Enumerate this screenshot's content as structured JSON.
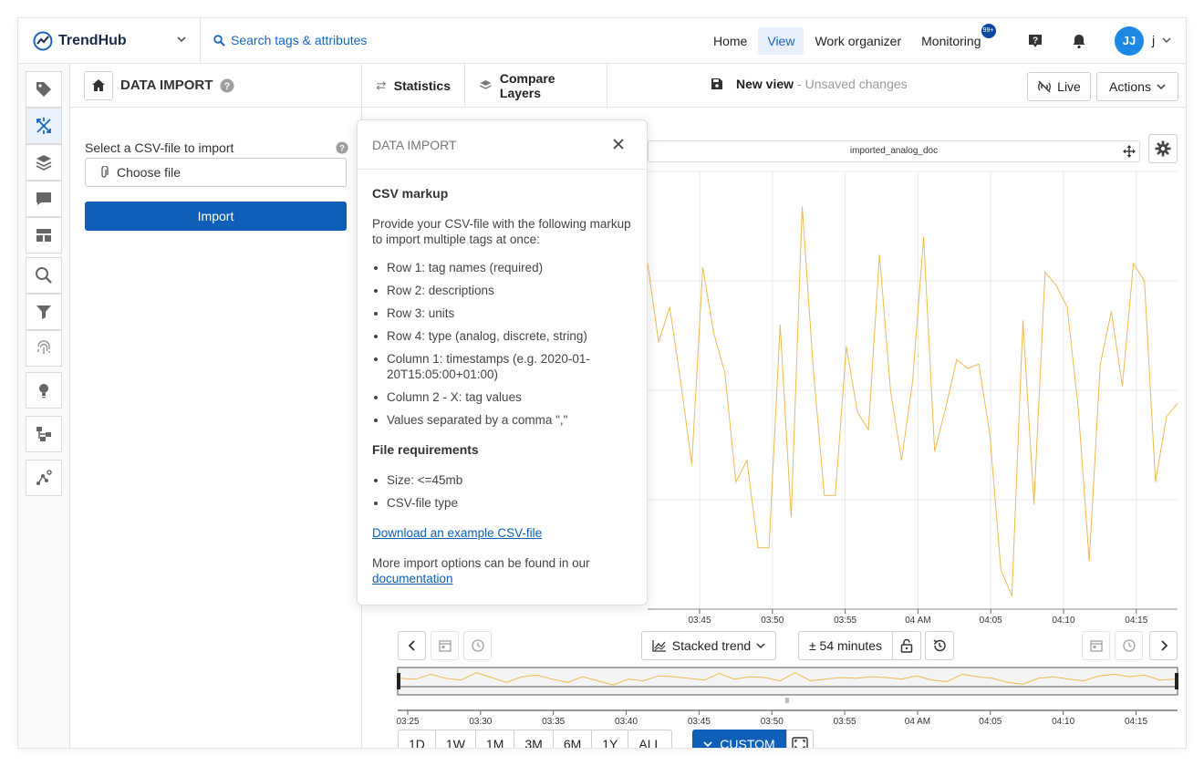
{
  "app": {
    "brand": "TrendHub"
  },
  "topnav": {
    "search_label": "Search tags & attributes",
    "links": [
      {
        "label": "Home",
        "active": false
      },
      {
        "label": "View",
        "active": true
      },
      {
        "label": "Work organizer",
        "active": false
      },
      {
        "label": "Monitoring",
        "active": false,
        "badge": "99+"
      }
    ],
    "avatar_initials": "JJ",
    "user_label": "j"
  },
  "iconbar": {
    "items": [
      "tag-icon",
      "data-import-icon",
      "layers-icon",
      "comment-icon",
      "dashboard-icon",
      "search-icon",
      "filter-icon",
      "fingerprint-icon",
      "lightbulb-icon",
      "hierarchy-icon",
      "graph-icon"
    ]
  },
  "panel": {
    "title": "DATA IMPORT",
    "csv_label": "Select a CSV-file to import",
    "choose_file": "Choose file",
    "import_label": "Import"
  },
  "toolbar": {
    "statistics": "Statistics",
    "compare_layers": "Compare Layers",
    "view_name": "New view",
    "view_status": "- Unsaved changes",
    "live": "Live",
    "actions": "Actions"
  },
  "chart": {
    "tag_name": "imported_analog_doc",
    "line_color": "#f0b94f"
  },
  "chart_data": {
    "type": "line",
    "series": [
      {
        "values": [
          0.79,
          0.61,
          0.69,
          0.52,
          0.33,
          0.78,
          0.63,
          0.54,
          0.29,
          0.34,
          0.14,
          0.14,
          0.65,
          0.21,
          0.92,
          0.55,
          0.26,
          0.26,
          0.6,
          0.45,
          0.41,
          0.81,
          0.5,
          0.34,
          0.52,
          0.85,
          0.36,
          0.46,
          0.57,
          0.55,
          0.56,
          0.4,
          0.09,
          0.03,
          0.66,
          0.24,
          0.77,
          0.74,
          0.69,
          0.46,
          0.11,
          0.56,
          0.68,
          0.51,
          0.79,
          0.75,
          0.29,
          0.44,
          0.47
        ]
      }
    ],
    "x_ticks_main": [
      "03:45",
      "03:50",
      "03:55",
      "04 AM",
      "04:05",
      "04:10",
      "04:15"
    ],
    "x_ticks_navigator": [
      "03:25",
      "03:30",
      "03:35",
      "03:40",
      "03:45",
      "03:50",
      "03:55",
      "04 AM",
      "04:05",
      "04:10",
      "04:15"
    ],
    "navigator_values": [
      0.45,
      0.4,
      0.7,
      0.45,
      0.35,
      0.8,
      0.5,
      0.2,
      0.55,
      0.65,
      0.4,
      0.2,
      0.55,
      0.3,
      0.05,
      0.4,
      0.3,
      0.6,
      0.55,
      0.45,
      0.35,
      0.75,
      0.4,
      0.55,
      0.5,
      0.3,
      0.8,
      0.3,
      0.4,
      0.5,
      0.45,
      0.55,
      0.5,
      0.4,
      0.6,
      0.35,
      0.25,
      0.7,
      0.55,
      0.45,
      0.2,
      0.1,
      0.45,
      0.55,
      0.4,
      0.3,
      0.6,
      0.7,
      0.55,
      0.65,
      0.35,
      0.4
    ],
    "grid": true
  },
  "controls": {
    "chart_mode": "Stacked trend",
    "window": "± 54 minutes",
    "ranges": [
      "1D",
      "1W",
      "1M",
      "3M",
      "6M",
      "1Y",
      "ALL"
    ],
    "custom": "CUSTOM"
  },
  "popover": {
    "title": "DATA IMPORT",
    "h1": "CSV markup",
    "intro": "Provide your CSV-file with the following markup to import multiple tags at once:",
    "markup_items": [
      "Row 1: tag names (required)",
      "Row 2: descriptions",
      "Row 3: units",
      "Row 4: type (analog, discrete, string)",
      "Column 1: timestamps (e.g. 2020-01-20T15:05:00+01:00)",
      "Column 2 - X: tag values",
      "Values separated by a comma \",\""
    ],
    "h2": "File requirements",
    "req_items": [
      "Size: <=45mb",
      "CSV-file type"
    ],
    "download_link": "Download an example CSV-file",
    "more_text": "More import options can be found in our",
    "docs_link": "documentation"
  }
}
